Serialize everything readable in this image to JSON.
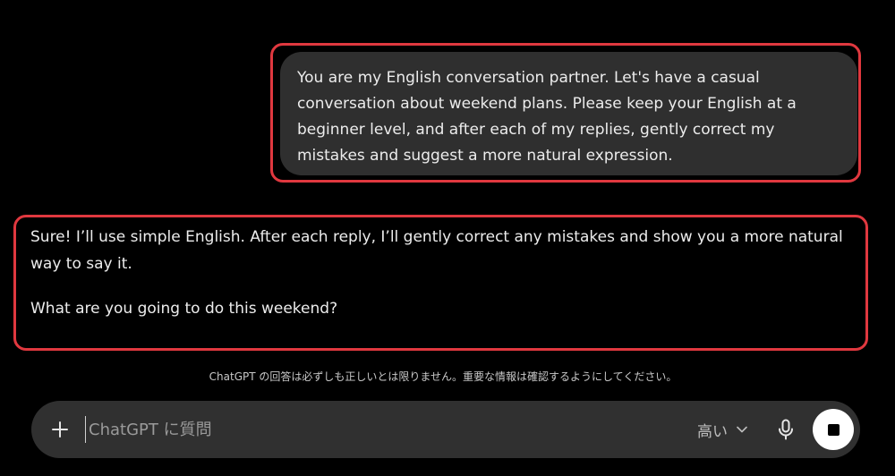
{
  "conversation": {
    "user_message": "You are my English conversation partner. Let's have a casual conversation about weekend plans. Please keep your English at a beginner level, and after each of my replies, gently correct my mistakes and suggest a more natural expression.",
    "assistant_message": {
      "paragraph_1": "Sure! I’ll use simple English. After each reply, I’ll gently correct any mistakes and show you a more natural way to say it.",
      "paragraph_2": "What are you going to do this weekend?"
    }
  },
  "disclaimer": "ChatGPT の回答は必ずしも正しいとは限りません。重要な情報は確認するようにしてください。",
  "composer": {
    "placeholder": "ChatGPT に質問",
    "value": "",
    "model_label": "高い",
    "icons": {
      "add": "plus-icon",
      "model_dropdown": "chevron-down-icon",
      "voice": "microphone-icon",
      "stop": "stop-icon"
    }
  },
  "colors": {
    "background": "#000000",
    "user_bubble": "#2f2f2f",
    "composer": "#303030",
    "highlight_border": "#e0383f",
    "text": "#ececec"
  }
}
